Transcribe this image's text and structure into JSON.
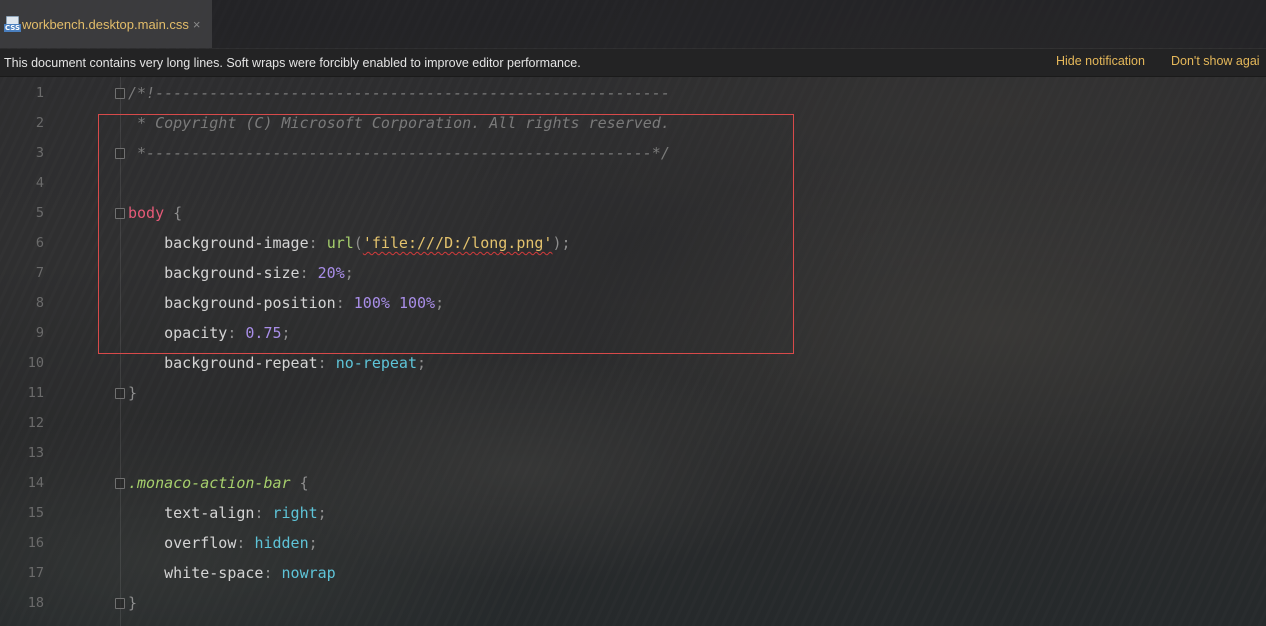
{
  "tab": {
    "icon": "css-file-icon",
    "icon_label": "CSS",
    "title": "workbench.desktop.main.css",
    "close": "×"
  },
  "notification": {
    "message": "This document contains very long lines. Soft wraps were forcibly enabled to improve editor performance.",
    "hide_label": "Hide notification",
    "dont_show_label": "Don't show agai"
  },
  "editor": {
    "lines": [
      {
        "n": "1",
        "tokens": [
          {
            "t": "/*!---------------------------------------------------------",
            "c": "comment"
          }
        ]
      },
      {
        "n": "2",
        "tokens": [
          {
            "t": " * Copyright (C) Microsoft Corporation. All rights reserved.",
            "c": "comment"
          }
        ]
      },
      {
        "n": "3",
        "tokens": [
          {
            "t": " *--------------------------------------------------------*/",
            "c": "comment"
          }
        ]
      },
      {
        "n": "4",
        "tokens": []
      },
      {
        "n": "5",
        "tokens": [
          {
            "t": "body",
            "c": "sel"
          },
          {
            "t": " {",
            "c": "punc"
          }
        ]
      },
      {
        "n": "6",
        "tokens": [
          {
            "t": "    background-image",
            "c": "prop"
          },
          {
            "t": ": ",
            "c": "punc"
          },
          {
            "t": "url",
            "c": "fn"
          },
          {
            "t": "(",
            "c": "punc"
          },
          {
            "t": "'file:///D:/long.png'",
            "c": "str"
          },
          {
            "t": ");",
            "c": "punc"
          }
        ]
      },
      {
        "n": "7",
        "tokens": [
          {
            "t": "    background-size",
            "c": "prop"
          },
          {
            "t": ": ",
            "c": "punc"
          },
          {
            "t": "20%",
            "c": "num"
          },
          {
            "t": ";",
            "c": "punc"
          }
        ]
      },
      {
        "n": "8",
        "tokens": [
          {
            "t": "    background-position",
            "c": "prop"
          },
          {
            "t": ": ",
            "c": "punc"
          },
          {
            "t": "100%",
            "c": "num"
          },
          {
            "t": " ",
            "c": "punc"
          },
          {
            "t": "100%",
            "c": "num"
          },
          {
            "t": ";",
            "c": "punc"
          }
        ]
      },
      {
        "n": "9",
        "tokens": [
          {
            "t": "    opacity",
            "c": "prop"
          },
          {
            "t": ": ",
            "c": "punc"
          },
          {
            "t": "0.75",
            "c": "num"
          },
          {
            "t": ";",
            "c": "punc"
          }
        ]
      },
      {
        "n": "10",
        "tokens": [
          {
            "t": "    background-repeat",
            "c": "prop"
          },
          {
            "t": ": ",
            "c": "punc"
          },
          {
            "t": "no-repeat",
            "c": "kw"
          },
          {
            "t": ";",
            "c": "punc"
          }
        ]
      },
      {
        "n": "11",
        "tokens": [
          {
            "t": "}",
            "c": "punc"
          }
        ]
      },
      {
        "n": "12",
        "tokens": []
      },
      {
        "n": "13",
        "tokens": []
      },
      {
        "n": "14",
        "tokens": [
          {
            "t": ".monaco-action-bar",
            "c": "cls"
          },
          {
            "t": " {",
            "c": "punc"
          }
        ]
      },
      {
        "n": "15",
        "tokens": [
          {
            "t": "    text-align",
            "c": "prop"
          },
          {
            "t": ": ",
            "c": "punc"
          },
          {
            "t": "right",
            "c": "kw"
          },
          {
            "t": ";",
            "c": "punc"
          }
        ]
      },
      {
        "n": "16",
        "tokens": [
          {
            "t": "    overflow",
            "c": "prop"
          },
          {
            "t": ": ",
            "c": "punc"
          },
          {
            "t": "hidden",
            "c": "kw"
          },
          {
            "t": ";",
            "c": "punc"
          }
        ]
      },
      {
        "n": "17",
        "tokens": [
          {
            "t": "    white-space",
            "c": "prop"
          },
          {
            "t": ": ",
            "c": "punc"
          },
          {
            "t": "nowrap",
            "c": "kw"
          }
        ]
      },
      {
        "n": "18",
        "tokens": [
          {
            "t": "}",
            "c": "punc"
          }
        ]
      }
    ]
  },
  "colors": {
    "selector": "#e65a78",
    "class_selector": "#a6cf6c",
    "string": "#e3c26d",
    "number": "#a98ee8",
    "keyword": "#5ec4d8",
    "comment": "#7a7a7a",
    "highlight_border": "#d84a4a",
    "notification_link": "#e5b85a"
  }
}
